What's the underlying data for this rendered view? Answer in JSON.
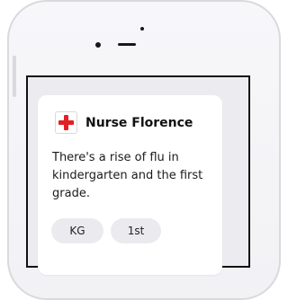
{
  "notification": {
    "sender": "Nurse Florence",
    "message": "There's a rise of flu in kindergarten and the first grade.",
    "icon": "red-cross-icon",
    "tags": [
      "KG",
      "1st"
    ]
  },
  "colors": {
    "cross_red": "#e12027",
    "tag_bg": "#ebebef"
  }
}
